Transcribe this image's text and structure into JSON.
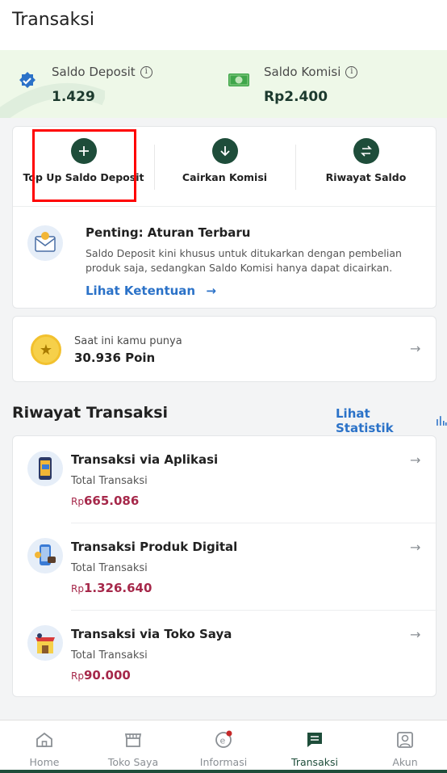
{
  "header": {
    "title": "Transaksi"
  },
  "saldo": {
    "deposit_label": "Saldo Deposit",
    "deposit_value": "1.429",
    "komisi_label": "Saldo Komisi",
    "komisi_value": "Rp2.400"
  },
  "actions": [
    {
      "label": "Top Up Saldo Deposit",
      "icon": "plus-icon"
    },
    {
      "label": "Cairkan Komisi",
      "icon": "arrow-down-icon"
    },
    {
      "label": "Riwayat Saldo",
      "icon": "swap-icon"
    }
  ],
  "notice": {
    "title": "Penting: Aturan Terbaru",
    "body": "Saldo Deposit kini khusus untuk ditukarkan dengan pembelian produk saja, sedangkan Saldo Komisi hanya dapat dicairkan.",
    "link": "Lihat Ketentuan"
  },
  "poin": {
    "caption": "Saat ini kamu punya",
    "value": "30.936 Poin"
  },
  "riwayat": {
    "title": "Riwayat Transaksi",
    "link": "Lihat Statistik",
    "items": [
      {
        "title": "Transaksi via Aplikasi",
        "sub": "Total Transaksi",
        "currency": "Rp",
        "amount": "665.086"
      },
      {
        "title": "Transaksi Produk Digital",
        "sub": "Total Transaksi",
        "currency": "Rp",
        "amount": "1.326.640"
      },
      {
        "title": "Transaksi via Toko Saya",
        "sub": "Total Transaksi",
        "currency": "Rp",
        "amount": "90.000"
      }
    ]
  },
  "nav": [
    {
      "label": "Home",
      "icon": "home-icon"
    },
    {
      "label": "Toko Saya",
      "icon": "store-icon"
    },
    {
      "label": "Informasi",
      "icon": "info-icon"
    },
    {
      "label": "Transaksi",
      "icon": "receipt-icon",
      "active": true
    },
    {
      "label": "Akun",
      "icon": "account-icon"
    }
  ],
  "colors": {
    "primary": "#1e4d3a",
    "link": "#2b72c8",
    "amount": "#a6284a",
    "highlight": "#ff0000"
  }
}
